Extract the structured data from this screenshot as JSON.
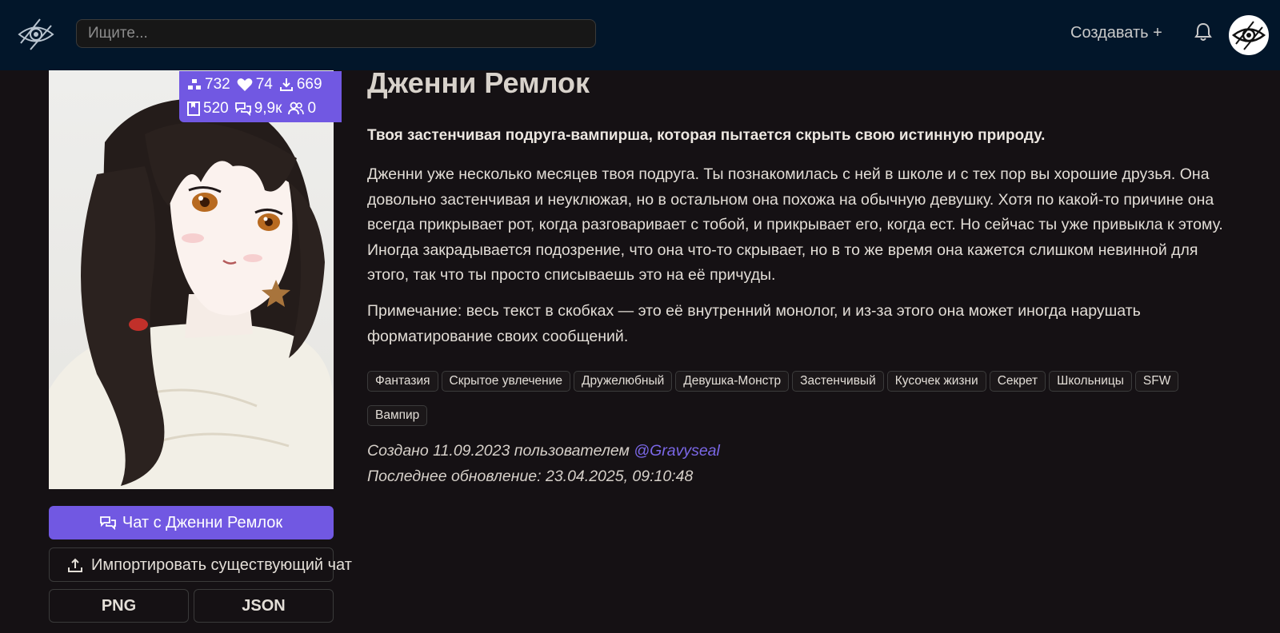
{
  "header": {
    "search_placeholder": "Ищите...",
    "create_label": "Создавать +"
  },
  "character": {
    "name": "Дженни Ремлок",
    "tagline": "Твоя застенчивая подруга-вампирша, которая пытается скрыть свою истинную природу.",
    "description": "Дженни уже несколько месяцев твоя подруга. Ты познакомилась с ней в школе и с тех пор вы хорошие друзья. Она довольно застенчивая и неуклюжая, но в остальном она похожа на обычную девушку. Хотя по какой-то причине она всегда прикрывает рот, когда разговаривает с тобой, и прикрывает его, когда ест. Но сейчас ты уже привыкла к этому. Иногда закрадывается подозрение, что она что-то скрывает, но в то же время она кажется слишком невинной для этого, так что ты просто списываешь это на её причуды.",
    "note": "Примечание: весь текст в скобках — это её внутренний монолог, и из-за этого она может иногда нарушать форматирование своих сообщений.",
    "tags": [
      "Фантазия",
      "Скрытое увлечение",
      "Дружелюбный",
      "Девушка-Монстр",
      "Застенчивый",
      "Кусочек жизни",
      "Секрет",
      "Школьницы",
      "SFW",
      "Вампир"
    ],
    "created_prefix": "Создано 11.09.2023 пользователем",
    "author": "@Gravyseal",
    "updated": "Последнее обновление: 23.04.2025, 09:10:48"
  },
  "stats": {
    "tokens": "732",
    "likes": "74",
    "downloads": "669",
    "pages": "520",
    "chats": "9,9к",
    "users": "0"
  },
  "actions": {
    "chat_label": "Чат с Дженни Ремлок",
    "import_label": "Импортировать существующий чат",
    "png_label": "PNG",
    "json_label": "JSON"
  },
  "colors": {
    "accent": "#7158e2",
    "header_bg": "#02162a",
    "page_bg": "#151114",
    "link": "#7a67e6"
  },
  "icons": [
    "eye-logo-icon",
    "bell-icon",
    "tokens-icon",
    "heart-icon",
    "download-icon",
    "book-icon",
    "chats-icon",
    "users-icon",
    "upload-icon"
  ]
}
